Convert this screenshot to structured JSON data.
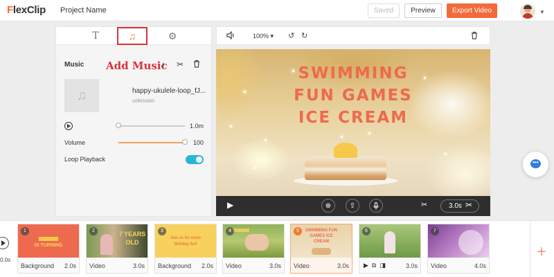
{
  "app": {
    "logo": "FlexClip",
    "project_name": "Project Name",
    "saved_label": "Saved",
    "preview_label": "Preview",
    "export_label": "Export Video"
  },
  "panel": {
    "tabs": [
      {
        "name": "text",
        "icon": "text-icon",
        "glyph": "T"
      },
      {
        "name": "music",
        "icon": "music-icon",
        "glyph": "♫",
        "active": true
      },
      {
        "name": "settings",
        "icon": "gear-icon",
        "glyph": "⚙"
      }
    ],
    "music_heading": "Music",
    "annotation": "Add Music",
    "track_name": "happy-ukulele-loop_fJ...",
    "track_artist": "unknown",
    "track_time": "1.0m",
    "volume_label": "Volume",
    "volume_value": "100",
    "volume_level": 1.0,
    "progress_level": 0.0,
    "loop_label": "Loop Playback",
    "loop_on": true
  },
  "editor": {
    "zoom": "100% ▾",
    "canvas_lines": [
      "SWIMMING",
      "FUN GAMES",
      "ICE CREAM"
    ],
    "duration": "3.0s"
  },
  "timeline": {
    "current_time": "0.0s",
    "clips": [
      {
        "num": "1",
        "type": "Background",
        "duration": "2.0s",
        "thumb_text": "IS TURNING",
        "selected": false
      },
      {
        "num": "2",
        "type": "Video",
        "duration": "3.0s",
        "thumb_text": "7 YEARS OLD",
        "selected": false
      },
      {
        "num": "3",
        "type": "Background",
        "duration": "2.0s",
        "thumb_text": "Join us for some birthday fun!",
        "selected": false
      },
      {
        "num": "4",
        "type": "Video",
        "duration": "3.0s",
        "thumb_text": "",
        "selected": false
      },
      {
        "num": "5",
        "type": "Video",
        "duration": "3.0s",
        "thumb_text": "SWIMMING FUN GAMES ICE CREAM",
        "selected": true
      },
      {
        "num": "6",
        "type": "",
        "duration": "3.0s",
        "thumb_text": "",
        "selected": false
      },
      {
        "num": "7",
        "type": "Video",
        "duration": "4.0s",
        "thumb_text": "",
        "selected": false
      }
    ]
  },
  "colors": {
    "accent": "#f26b3a",
    "annotation_red": "#d8323b",
    "toggle": "#29b5d8",
    "canvas_text": "#ee6a4e"
  }
}
